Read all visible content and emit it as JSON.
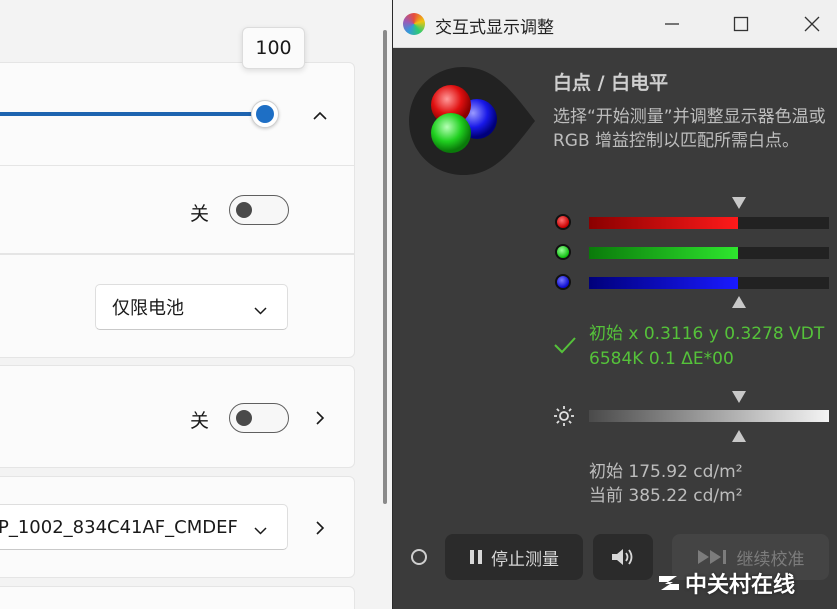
{
  "settings": {
    "slider": {
      "value_label": "100",
      "fraction": 1.0
    },
    "row1": {
      "toggle_label": "关",
      "toggle_on": false
    },
    "row2": {
      "dropdown_value": "仅限电池"
    },
    "row3": {
      "toggle_label": "关",
      "toggle_on": false
    },
    "row4": {
      "dropdown_value": "P_1002_834C41AF_CMDEF"
    }
  },
  "window": {
    "title": "交互式显示调整",
    "heading": "白点 / 白电平",
    "description": "选择“开始测量”并调整显示器色温或\nRGB 增益控制以匹配所需白点。",
    "rgb": {
      "red": {
        "fraction": 0.62,
        "color": "#c81414"
      },
      "green": {
        "fraction": 0.62,
        "color": "#1ec81e"
      },
      "blue": {
        "fraction": 0.62,
        "color": "#1414c8"
      }
    },
    "status_line1": "初始 x 0.3116 y 0.3278 VDT",
    "status_line2": "6584K 0.1 ΔE*00",
    "luminance_initial": "初始 175.92 cd/m²",
    "luminance_current": "当前 385.22 cd/m²",
    "buttons": {
      "stop": "停止测量",
      "continue": "继续校准"
    },
    "accent_green": "#55c23a"
  },
  "watermark": {
    "text": "中关村在线"
  }
}
